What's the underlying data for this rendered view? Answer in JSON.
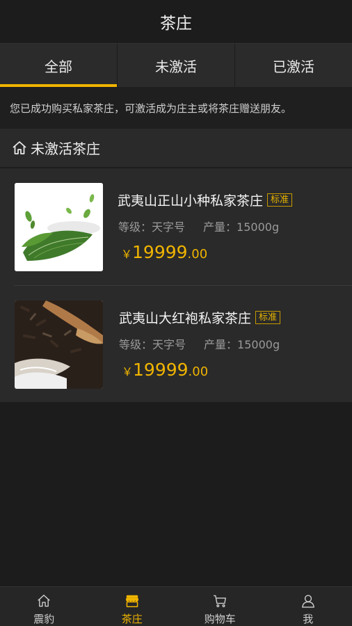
{
  "header": {
    "title": "茶庄"
  },
  "tabs": [
    {
      "label": "全部",
      "active": true
    },
    {
      "label": "未激活",
      "active": false
    },
    {
      "label": "已激活",
      "active": false
    }
  ],
  "notice": "您已成功购买私家茶庄，可激活成为庄主或将茶庄赠送朋友。",
  "section": {
    "title": "未激活茶庄",
    "icon": "home-outline-icon"
  },
  "items": [
    {
      "title": "武夷山正山小种私家茶庄",
      "badge": "标准",
      "grade_label": "等级：",
      "grade": "天字号",
      "output_label": "产量：",
      "output": "15000g",
      "currency": "￥",
      "price_int": "19999",
      "price_dec": ".00",
      "image": "green-tea-leaves"
    },
    {
      "title": "武夷山大红袍私家茶庄",
      "badge": "标准",
      "grade_label": "等级：",
      "grade": "天字号",
      "output_label": "产量：",
      "output": "15000g",
      "currency": "￥",
      "price_int": "19999",
      "price_dec": ".00",
      "image": "dark-tea-with-wooden-spoon"
    }
  ],
  "tabbar": [
    {
      "label": "震豹",
      "icon": "home-icon",
      "active": false
    },
    {
      "label": "茶庄",
      "icon": "store-icon",
      "active": true
    },
    {
      "label": "购物车",
      "icon": "cart-icon",
      "active": false
    },
    {
      "label": "我",
      "icon": "user-icon",
      "active": false
    }
  ],
  "colors": {
    "accent": "#f0b400",
    "background": "#1c1c1c",
    "panel": "#2a2a2a"
  }
}
